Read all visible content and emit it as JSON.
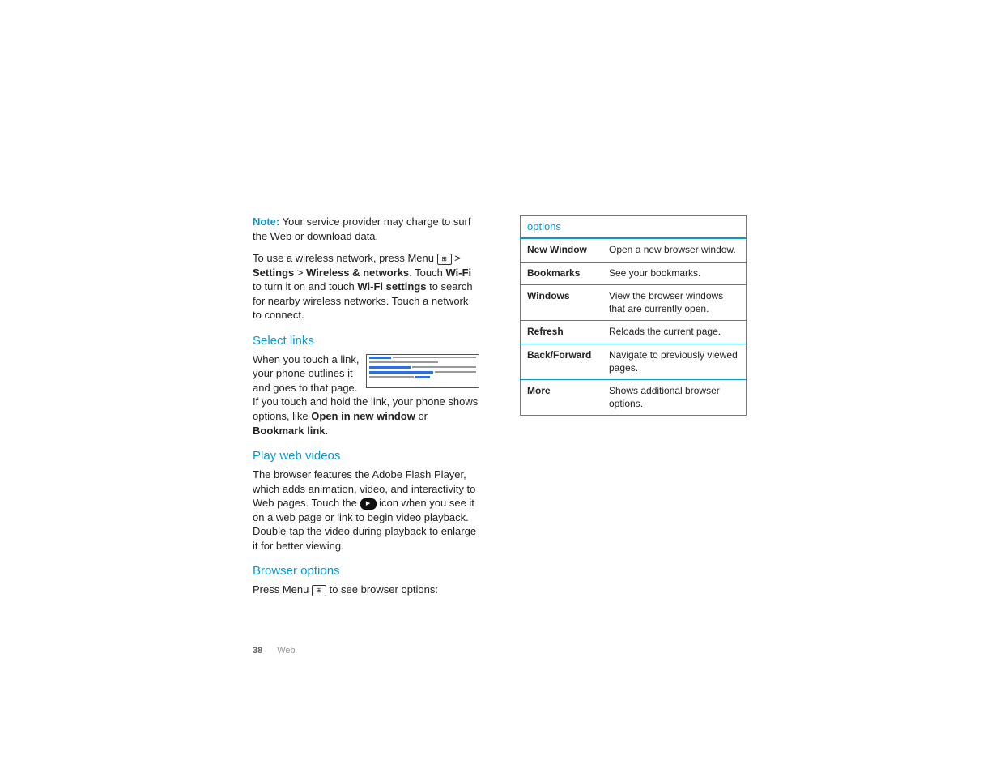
{
  "left": {
    "note_label": "Note:",
    "note_text": " Your service provider may charge to surf the Web or download data.",
    "wireless_p1a": "To use a wireless network, press Menu ",
    "wireless_p1b": " > ",
    "settings": "Settings",
    "wireless_p1c": " > ",
    "wn": "Wireless & networks",
    "wireless_p1d": ". Touch ",
    "wifi": "Wi-Fi",
    "wireless_p1e": " to turn it on and touch ",
    "wifisettings": "Wi-Fi settings",
    "wireless_p1f": " to search for nearby wireless networks. Touch a network to connect.",
    "h_selectlinks": "Select links",
    "selectlinks_a": "When you touch a link, your phone outlines it and goes to that page. If you touch and hold the link, your phone shows options, like ",
    "open_new": "Open in new window",
    "selectlinks_or": " or ",
    "bookmark_link": "Bookmark link",
    "selectlinks_end": ".",
    "h_playvideos": "Play web videos",
    "playvideos_a": "The browser features the Adobe Flash Player, which adds animation, video, and interactivity to Web pages. Touch the ",
    "playvideos_b": " icon when you see it on a web page or link to begin video playback. Double-tap the video during playback to enlarge it for better viewing.",
    "h_browseroptions": "Browser options",
    "browseroptions_a": "Press Menu ",
    "browseroptions_b": " to see browser options:",
    "page_num": "38",
    "page_section": "Web"
  },
  "table": {
    "header": "options",
    "rows": [
      {
        "k": "New Window",
        "v": "Open a new browser window."
      },
      {
        "k": "Bookmarks",
        "v": "See your bookmarks."
      },
      {
        "k": "Windows",
        "v": "View the browser windows that are currently open."
      },
      {
        "k": "Refresh",
        "v": "Reloads the current page."
      },
      {
        "k": "Back/Forward",
        "v": "Navigate to previously viewed pages."
      },
      {
        "k": "More",
        "v": "Shows additional browser options."
      }
    ]
  }
}
